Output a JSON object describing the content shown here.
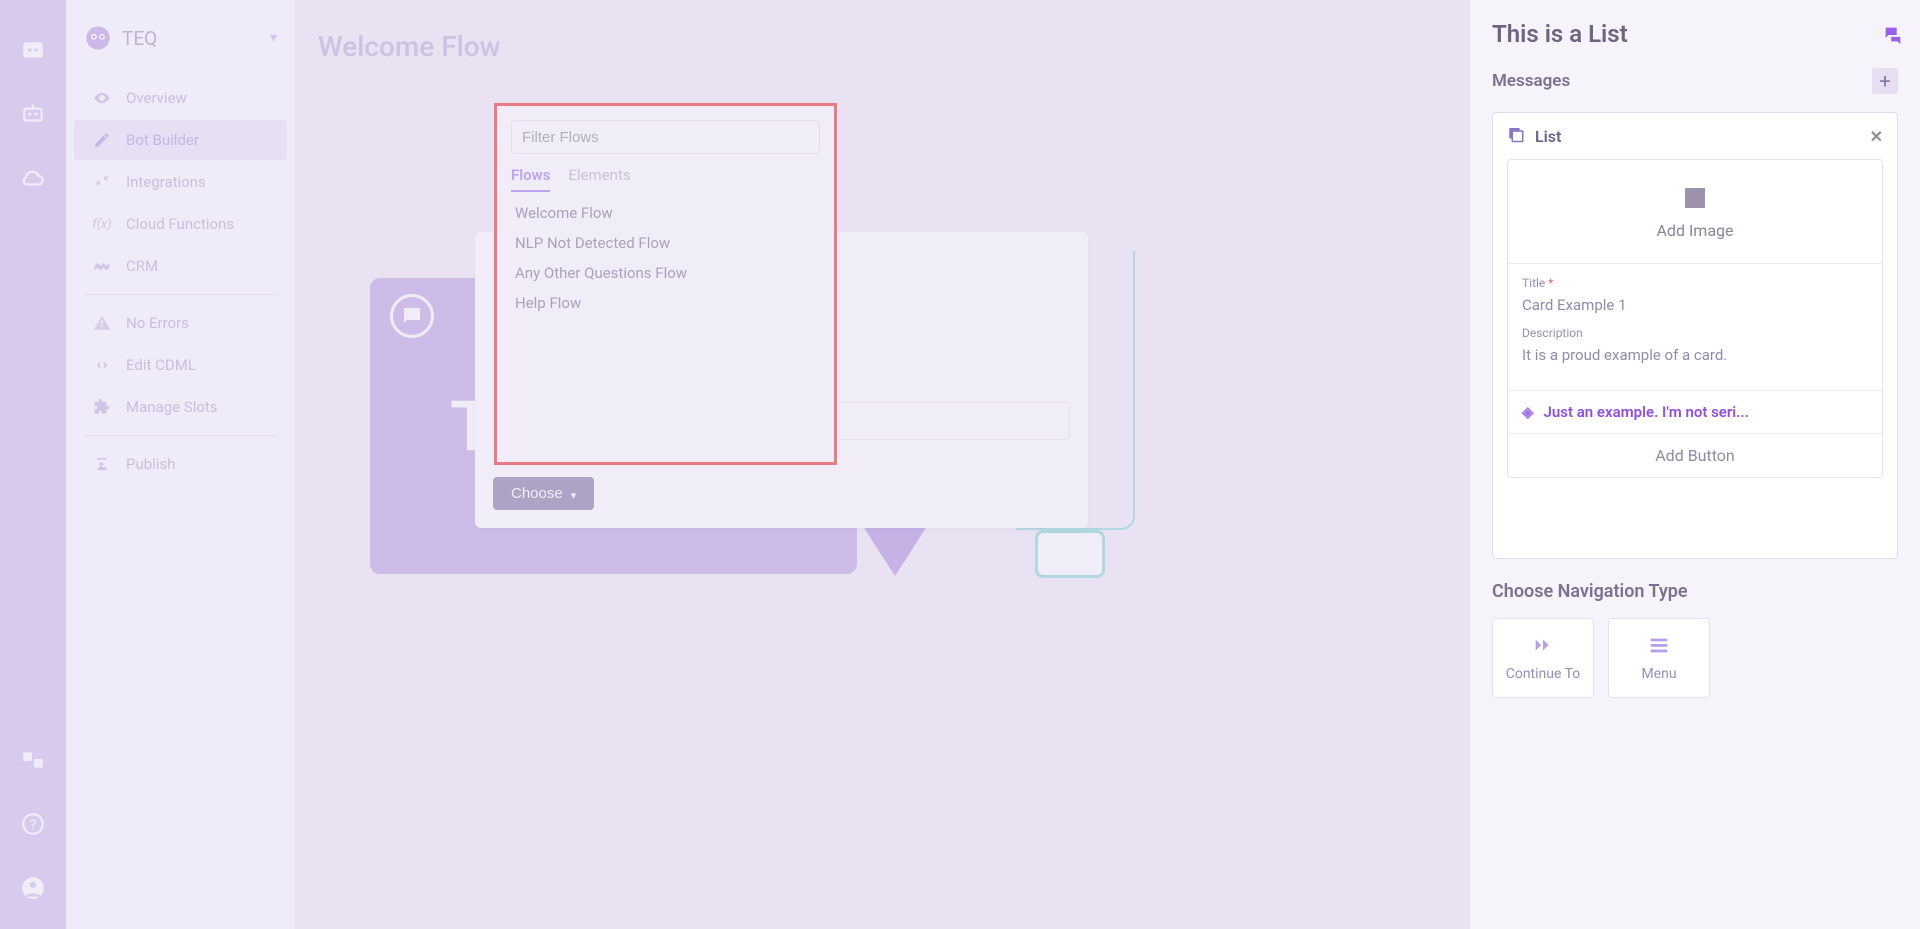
{
  "workspace": {
    "name": "TEQ"
  },
  "sidebar": {
    "items": [
      {
        "label": "Overview"
      },
      {
        "label": "Bot Builder"
      },
      {
        "label": "Integrations"
      },
      {
        "label": "Cloud Functions"
      },
      {
        "label": "CRM"
      },
      {
        "label": "No Errors"
      },
      {
        "label": "Edit CDML"
      },
      {
        "label": "Manage Slots"
      },
      {
        "label": "Publish"
      }
    ]
  },
  "page": {
    "title": "Welcome Flow"
  },
  "popup": {
    "choose_label": "Choose",
    "filter_placeholder": "Filter Flows",
    "tabs": {
      "flows": "Flows",
      "elements": "Elements"
    },
    "flows": [
      "Welcome Flow",
      "NLP Not Detected Flow",
      "Any Other Questions Flow",
      "Help Flow"
    ]
  },
  "panel": {
    "title": "This is a List",
    "section": "Messages",
    "message_type": "List",
    "add_image": "Add Image",
    "title_label": "Title",
    "title_value": "Card Example 1",
    "desc_label": "Description",
    "desc_value": "It is a proud example of a card.",
    "example_text": "Just an example. I'm not seri...",
    "add_button": "Add Button",
    "nav_label": "Choose Navigation Type",
    "nav_continue": "Continue To",
    "nav_menu": "Menu"
  }
}
